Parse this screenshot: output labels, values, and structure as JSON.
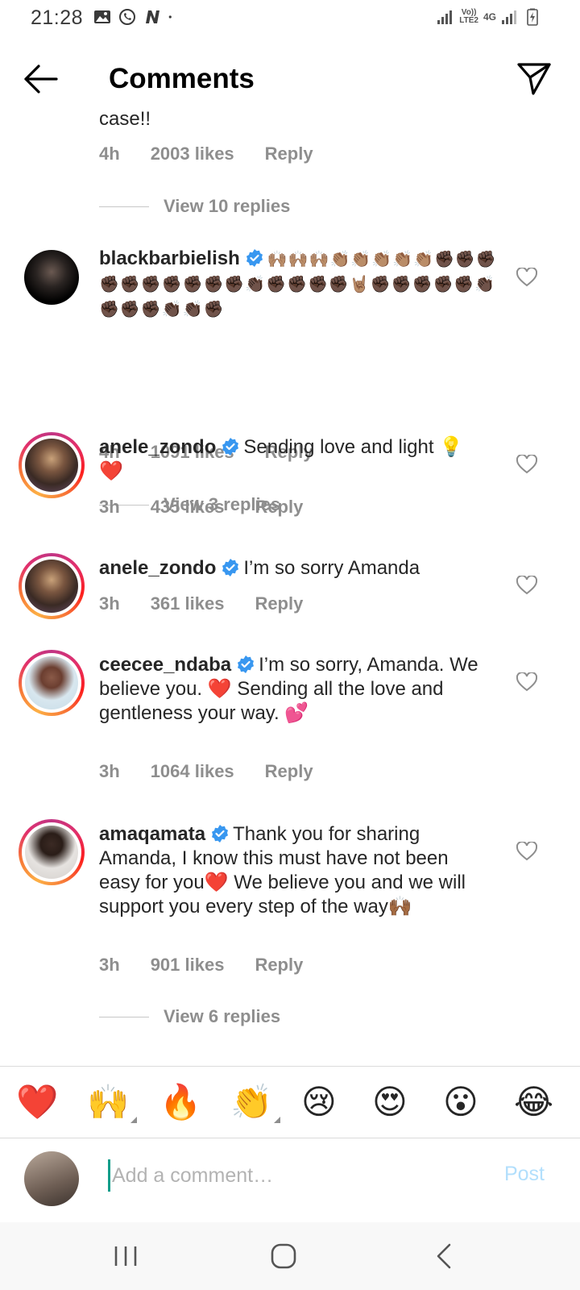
{
  "status_bar": {
    "time": "21:28",
    "network_top": "Vo))",
    "network_bottom": "LTE2",
    "net_type": "4G",
    "icons": [
      "gallery-icon",
      "whatsapp-icon",
      "n-app-icon",
      "dot-icon",
      "signal-icon",
      "signal-icon",
      "battery-charging-icon"
    ]
  },
  "header": {
    "title": "Comments",
    "back_icon": "arrow-left-icon",
    "share_icon": "paper-plane-icon"
  },
  "comments": {
    "partial": {
      "text": "case!!",
      "time": "4h",
      "likes": "2003 likes",
      "reply": "Reply",
      "view_replies": "View 10 replies"
    },
    "items": [
      {
        "username": "blackbarbielish",
        "text": "🙌🏽🙌🏽🙌🏽👏🏽👏🏽👏🏽👏🏽👏🏽✊🏿✊🏿✊🏿✊🏿✊🏿✊🏿✊🏿✊🏿✊🏿✊🏿👏🏿✊🏿✊🏿✊🏿✊🏿🤘🏽✊🏿✊🏿✊🏿✊🏿✊🏿👏🏿✊🏿✊🏿✊🏿👏🏿👏🏿✊🏿",
        "time": "4h",
        "likes": "1091 likes",
        "reply": "Reply",
        "view_replies": "View 3 replies"
      },
      {
        "username": "anele_zondo",
        "text": "Sending love and light 💡 ❤️",
        "time": "3h",
        "likes": "435 likes",
        "reply": "Reply"
      },
      {
        "username": "anele_zondo",
        "text": "I’m so sorry Amanda",
        "time": "3h",
        "likes": "361 likes",
        "reply": "Reply"
      },
      {
        "username": "ceecee_ndaba",
        "text": "I’m so sorry, Amanda. We believe you. ❤️ Sending all the love and gentleness your way. 💕",
        "time": "3h",
        "likes": "1064 likes",
        "reply": "Reply"
      },
      {
        "username": "amaqamata",
        "text": "Thank you for sharing Amanda, I know this must have not been easy for you❤️ We believe you and we will support you every step of the way🙌🏾",
        "time": "3h",
        "likes": "901 likes",
        "reply": "Reply",
        "view_replies": "View 6 replies"
      }
    ]
  },
  "reactions": [
    "❤️",
    "🙌",
    "🔥",
    "👏",
    "😢",
    "😍",
    "😮",
    "😂"
  ],
  "input": {
    "placeholder": "Add a comment…",
    "post_label": "Post"
  },
  "nav_bar": {
    "recents_icon": "recents-icon",
    "home_icon": "home-icon",
    "back_icon": "back-chevron-icon"
  }
}
